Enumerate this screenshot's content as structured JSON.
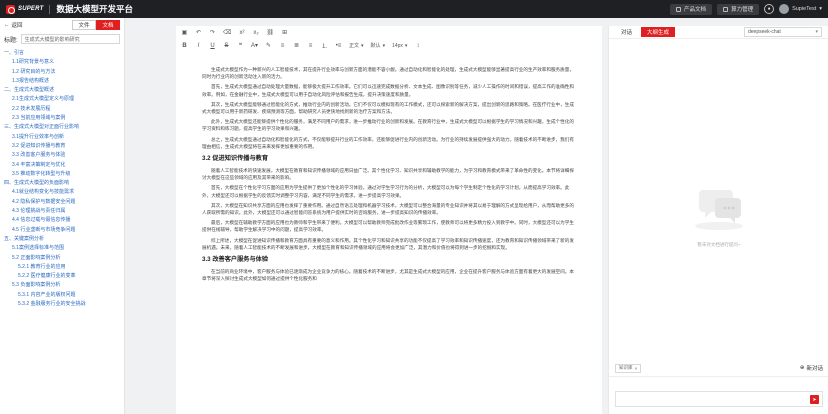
{
  "topbar": {
    "brand": "SUPERT",
    "app_title": "数据大模型开发平台",
    "btn_docs": "产品文档",
    "btn_compute": "算力管理",
    "user": "SupieTest"
  },
  "left": {
    "back": "返回",
    "tab_file": "文件",
    "tab_doc": "文档",
    "title_label": "标题:",
    "title_value": "生成式大模型的影响研究",
    "outline": [
      {
        "text": "一、引言",
        "level": 1
      },
      {
        "text": "1.1研究背景与意义",
        "level": 2
      },
      {
        "text": "1.2 研究目的与方法",
        "level": 2
      },
      {
        "text": "1.3报告结构概述",
        "level": 2
      },
      {
        "text": "二、生成式大模型概述",
        "level": 1
      },
      {
        "text": "2.1生成式大模型定义与原理",
        "level": 2
      },
      {
        "text": "2.2 技术发展历程",
        "level": 2
      },
      {
        "text": "2.3 当前应用领域与案例",
        "level": 2
      },
      {
        "text": "三、生成式大模型对正面行业影响",
        "level": 1
      },
      {
        "text": "3.1提升行业效率与创新",
        "level": 2
      },
      {
        "text": "3.2 促进知识传播与教育",
        "level": 2
      },
      {
        "text": "3.3 改善客户服务与体验",
        "level": 2
      },
      {
        "text": "3.4 丰富决策制定与优化",
        "level": 2
      },
      {
        "text": "3.5 推动数字化转型与升级",
        "level": 2
      },
      {
        "text": "四、生成式大模型的负面影响",
        "level": 1
      },
      {
        "text": "4.1就业结构变化与技能需求",
        "level": 2
      },
      {
        "text": "4.2 隐私保护与数据安全问题",
        "level": 2
      },
      {
        "text": "4.3 伦理挑战与责任归属",
        "level": 2
      },
      {
        "text": "4.4 信息过载与假信息传播",
        "level": 2
      },
      {
        "text": "4.5 行业垄断与市场竞争问题",
        "level": 2
      },
      {
        "text": "五、关键案例分析",
        "level": 1
      },
      {
        "text": "5.1案例选择标准与范围",
        "level": 2
      },
      {
        "text": "5.2 正面影响案例分析",
        "level": 2
      },
      {
        "text": "5.2.1 教育行业的应用",
        "level": 3
      },
      {
        "text": "5.2.2 医疗健康行业的变革",
        "level": 3
      },
      {
        "text": "5.3 负面影响案例分析",
        "level": 2
      },
      {
        "text": "5.3.1 内容产业的版权问题",
        "level": 3
      },
      {
        "text": "5.3.2 金融服务行业的安全挑战",
        "level": 3
      }
    ]
  },
  "toolbar": {
    "heading_select": "正文",
    "font_select": "默认",
    "size_select": "14px"
  },
  "doc": {
    "p1": "生成式大模型作为一种新兴的人工智能技术，其在提升行业效率与创新方面的潜能不容小觑。通过自动化和智能化的处理，生成式大模型能够显著提高行业的生产效率和服务质量，同时为行业内的创新活动注入新的活力。",
    "p2": "首先，生成式大模型通过自动处理大量数据，能够极大提升工作效率。它们可以迅速完成数据分析、文本生成、图像识别等任务，减少人工操作的时间和错误，提高工作的准确性和效率。例如，在金融行业中，生成式大模型可以用于自动化风险评估和报告生成，提升决策速度和质量。",
    "p3": "其次，生成式大模型能够通过智能化的方式，推动行业内的创新活动。它们不仅可以模拟现有的工作模式，还可以探索新的解决方案，提出创新的思路和策略。在医疗行业中，生成式大模型可以用于新药研发、疾病预测等方面，帮助研究人员更快地找到新的治疗方案和方法。",
    "p4": "此外，生成式大模型还能够提供个性化的服务，满足不同用户的需求，进一步推动行业的创新和发展。在教育行业中，生成式大模型可以根据学生的学习情况和兴趣，生成个性化的学习资料和练习题，提高学生的学习效果和兴趣。",
    "p5": "总之，生成式大模型通过自动化和智能化的方式，不仅能够提升行业的工作效率，还能够促进行业内的创新活动。为行业的持续发展提供强大的动力。随着技术的不断进步，我们有理由相信，生成式大模型将在未来发挥更加重要的作用。",
    "h32": "3.2 促进知识传播与教育",
    "p6": "随着人工智能技术的快速发展，大模型在教育和知识传播领域的应用日益广泛。其个性化学习、知识共享和辅助教学的能力，为学习和教育模式带来了革命性的变化。本节将详细探讨大模型在这些领域的应用及其带来的影响。",
    "p7": "首先，大模型在个性化学习方面的应用为学生提供了更加个性化的学习体验。通过对学生学习行为的分析，大模型可以为每个学生制定个性化的学习计划，从而提高学习效率。此外，大模型还可以根据学生的反馈实时调整学习内容，满足不同学生的需求，进一步提高学习效果。",
    "p8": "其次，大模型在知识共享方面的应用也发挥了重要作用。通过自然语言处理和机器学习技术，大模型可以整合海量的专业知识并将其以易于理解的方式呈现给用户，从而帮助更多的人获取所需的知识。此外，大模型还可以通过智能问答系统为用户提供实时的咨询服务，进一步提高知识的传播效率。",
    "p9": "最后，大模型在辅助教学方面的应用也为教师和学生带来了便利。大模型可以帮助教师完成批改作业等繁琐工作，使教师可以将更多精力投入到教学中。同时，大模型还可以为学生提供在线辅导，帮助学生解决学习中的问题，提高学习效率。",
    "p10": "综上所述，大模型在促进知识传播和教育方面具有重要的意义和作用。其个性化学习和知识共享的功能不仅提高了学习效率和知识传播速度，还为教育和知识传播领域带来了新的发展机遇。未来，随着人工智能技术的不断发展和进步，大模型在教育和知识传播领域的应用将会更加广泛，其潜力和价值也将得到进一步的挖掘和实现。",
    "h33": "3.3 改善客户服务与体验",
    "p11": "在当前的商业环境中，客户服务与体验已逐渐成为企业竞争力的核心。随着技术的不断进步，尤其是生成式大模型的应用，企业在提升客户服务与体验方面有着更大的发展空间。本章节将深入探讨生成式大模型如何通过提供个性化服务和"
  },
  "right": {
    "tab_chat": "对话",
    "tab_gen": "大纲生成",
    "model": "deepseek-chat",
    "empty_text": "暂未对文档进行提问~",
    "kb_tag": "知识库",
    "new_chat": "新对话",
    "colors": {
      "accent": "#e02020"
    }
  }
}
